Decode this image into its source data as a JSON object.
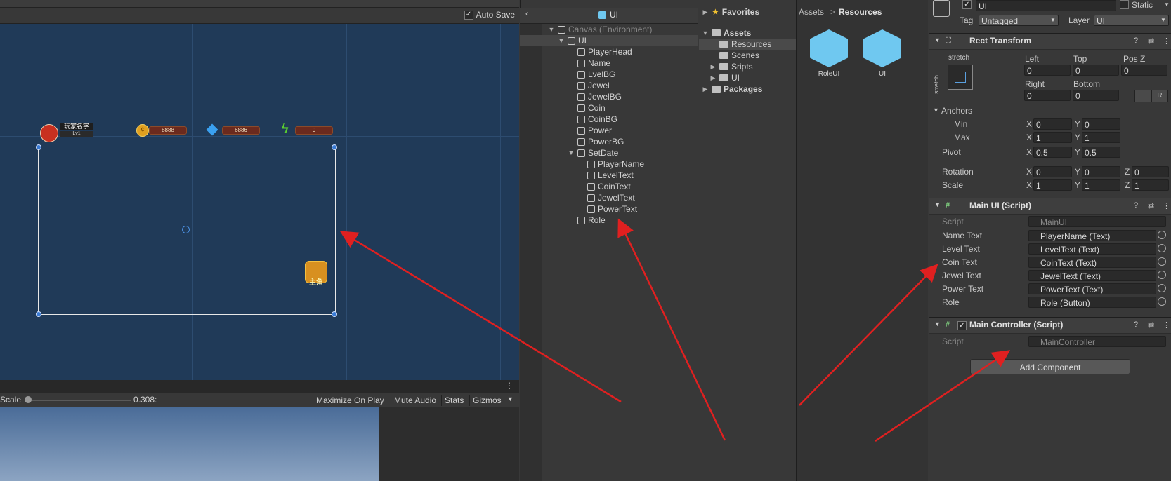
{
  "scene": {
    "auto_save_label": "Auto Save",
    "gizmos_label": "Gizmos",
    "hud": {
      "player_name": "玩家名字",
      "level": "Lv1",
      "coin_value": "8888",
      "jewel_value": "6886",
      "power_value": "0",
      "role_label": "主角"
    }
  },
  "game_toolbar": {
    "scale_label": "Scale",
    "scale_value": "0.308:",
    "maximize_on_play": "Maximize On Play",
    "mute_audio": "Mute Audio",
    "stats": "Stats",
    "gizmos": "Gizmos",
    "more_glyph": "⋮"
  },
  "hierarchy": {
    "header_title": "UI",
    "items": [
      {
        "label": "Canvas (Environment)",
        "depth": 0,
        "expanded": true
      },
      {
        "label": "UI",
        "depth": 1,
        "expanded": true
      },
      {
        "label": "PlayerHead",
        "depth": 2
      },
      {
        "label": "Name",
        "depth": 2
      },
      {
        "label": "LvelBG",
        "depth": 2
      },
      {
        "label": "Jewel",
        "depth": 2
      },
      {
        "label": "JewelBG",
        "depth": 2
      },
      {
        "label": "Coin",
        "depth": 2
      },
      {
        "label": "CoinBG",
        "depth": 2
      },
      {
        "label": "Power",
        "depth": 2
      },
      {
        "label": "PowerBG",
        "depth": 2
      },
      {
        "label": "SetDate",
        "depth": 2,
        "expanded": true
      },
      {
        "label": "PlayerName",
        "depth": 3
      },
      {
        "label": "LevelText",
        "depth": 3
      },
      {
        "label": "CoinText",
        "depth": 3
      },
      {
        "label": "JewelText",
        "depth": 3
      },
      {
        "label": "PowerText",
        "depth": 3
      },
      {
        "label": "Role",
        "depth": 2
      }
    ]
  },
  "project": {
    "favorites": "Favorites",
    "assets": "Assets",
    "folders": [
      "Resources",
      "Scenes",
      "Sripts",
      "UI"
    ],
    "packages": "Packages",
    "breadcrumb": [
      "Assets",
      "Resources"
    ],
    "breadcrumb_sep": ">",
    "files": [
      "RoleUI",
      "UI"
    ]
  },
  "inspector": {
    "object_name": "UI",
    "static_label": "Static",
    "tag_label": "Tag",
    "tag_value": "Untagged",
    "layer_label": "Layer",
    "layer_value": "UI",
    "rect_transform": {
      "title": "Rect Transform",
      "anchor_preset": "stretch",
      "left_label": "Left",
      "left": "0",
      "top_label": "Top",
      "top": "0",
      "posz_label": "Pos Z",
      "posz": "0",
      "right_label": "Right",
      "right": "0",
      "bottom_label": "Bottom",
      "bottom": "0",
      "r_button": "R",
      "anchors_label": "Anchors",
      "min_label": "Min",
      "min_x": "0",
      "min_y": "0",
      "max_label": "Max",
      "max_x": "1",
      "max_y": "1",
      "pivot_label": "Pivot",
      "pivot_x": "0.5",
      "pivot_y": "0.5",
      "rotation_label": "Rotation",
      "rot_x": "0",
      "rot_y": "0",
      "rot_z": "0",
      "scale_label": "Scale",
      "scale_x": "1",
      "scale_y": "1",
      "scale_z": "1",
      "x": "X",
      "y": "Y",
      "z": "Z"
    },
    "main_ui": {
      "title": "Main UI (Script)",
      "script_label": "Script",
      "script_value": "MainUI",
      "fields": [
        {
          "label": "Name Text",
          "value": "PlayerName (Text)"
        },
        {
          "label": "Level Text",
          "value": "LevelText (Text)"
        },
        {
          "label": "Coin Text",
          "value": "CoinText (Text)"
        },
        {
          "label": "Jewel Text",
          "value": "JewelText (Text)"
        },
        {
          "label": "Power Text",
          "value": "PowerText (Text)"
        },
        {
          "label": "Role",
          "value": "Role (Button)"
        }
      ]
    },
    "main_controller": {
      "title": "Main Controller (Script)",
      "script_label": "Script",
      "script_value": "MainController"
    },
    "add_component": "Add Component"
  },
  "colors": {
    "annotation_arrow": "#e02020",
    "scene_bg": "#203a58",
    "asset_cube": "#6fc8f0"
  }
}
